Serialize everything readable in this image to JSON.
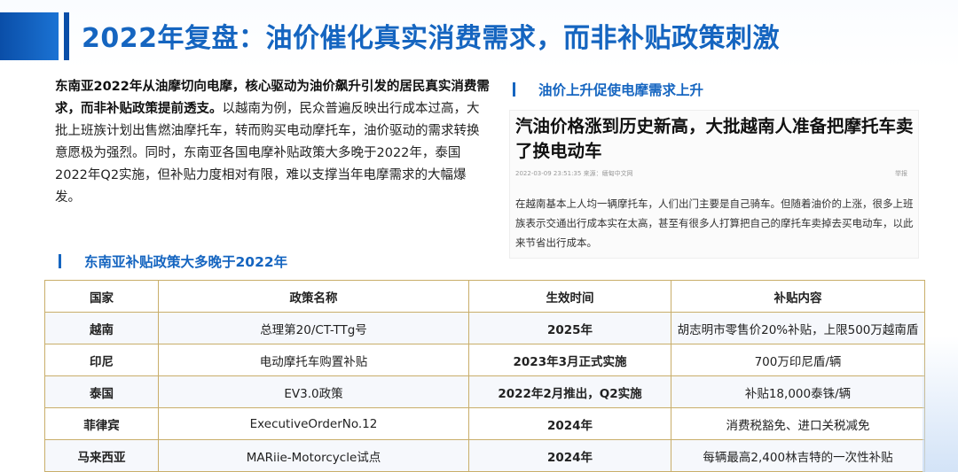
{
  "title": "2022年复盘：油价催化真实消费需求，而非补贴政策刺激",
  "intro": {
    "bold_part": "东南亚2022年从油摩切向电摩，核心驱动为油价飙升引发的居民真实消费需求，而非补贴政策提前透支。",
    "rest_part": "以越南为例，民众普遍反映出行成本过高，大批上班族计划出售燃油摩托车，转而购买电动摩托车，油价驱动的需求转换意愿极为强烈。同时，东南亚各国电摩补贴政策大多晚于2022年，泰国2022年Q2实施，但补贴力度相对有限，难以支撑当年电摩需求的大幅爆发。"
  },
  "right_section_title": "油价上升促使电摩需求上升",
  "news": {
    "headline": "汽油价格涨到历史新高，大批越南人准备把摩托车卖了换电动车",
    "meta": "2022-03-09 23:51:35 来源：缅甸中文网",
    "report_label": "举报",
    "body": "在越南基本上人均一辆摩托车，人们出门主要是自己骑车。但随着油价的上涨，很多上班族表示交通出行成本实在太高，甚至有很多人打算把自己的摩托车卖掉去买电动车，以此来节省出行成本。"
  },
  "table_section_title": "东南亚补贴政策大多晚于2022年",
  "table": {
    "headers": {
      "country": "国家",
      "policy": "政策名称",
      "date": "生效时间",
      "subsidy": "补贴内容"
    },
    "rows": [
      {
        "country": "越南",
        "policy": "总理第20/CT-TTg号",
        "date": "2025年",
        "subsidy": "胡志明市零售价20%补贴，上限500万越南盾"
      },
      {
        "country": "印尼",
        "policy": "电动摩托车购置补贴",
        "date": "2023年3月正式实施",
        "subsidy": "700万印尼盾/辆"
      },
      {
        "country": "泰国",
        "policy": "EV3.0政策",
        "date": "2022年2月推出，Q2实施",
        "subsidy": "补贴18,000泰铢/辆"
      },
      {
        "country": "菲律宾",
        "policy": "ExecutiveOrderNo.12",
        "date": "2024年",
        "subsidy": "消费税豁免、进口关税减免"
      },
      {
        "country": "马来西亚",
        "policy": "MARiie-Motorcycle试点",
        "date": "2024年",
        "subsidy": "每辆最高2,400林吉特的一次性补贴"
      }
    ]
  },
  "colors": {
    "accent": "#1565c0",
    "table_border": "#c9ae6a"
  }
}
